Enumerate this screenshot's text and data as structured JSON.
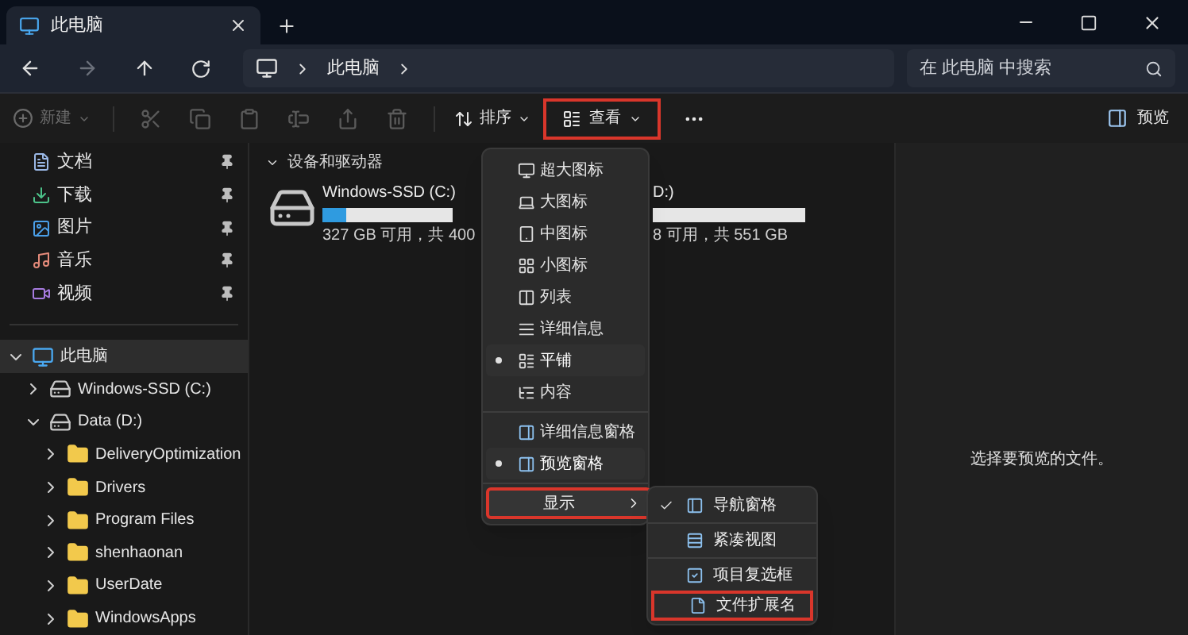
{
  "tab": {
    "title": "此电脑"
  },
  "address": {
    "path": [
      "此电脑"
    ]
  },
  "search": {
    "placeholder": "在 此电脑 中搜索"
  },
  "toolbar": {
    "new": {
      "label": "新建",
      "disabled": true
    },
    "edit_actions": [
      {
        "disabled": true
      },
      {
        "disabled": true
      },
      {
        "disabled": true
      },
      {
        "disabled": true
      },
      {
        "disabled": true
      },
      {
        "disabled": true
      }
    ],
    "sort": {
      "label": "排序"
    },
    "view": {
      "label": "查看",
      "highlighted": true
    },
    "preview": {
      "label": "预览"
    }
  },
  "sidebar": {
    "quick_access": [
      {
        "label": "文档",
        "pinned": true
      },
      {
        "label": "下载",
        "pinned": true
      },
      {
        "label": "图片",
        "pinned": true
      },
      {
        "label": "音乐",
        "pinned": true
      },
      {
        "label": "视频",
        "pinned": true
      }
    ],
    "tree": [
      {
        "label": "此电脑",
        "expanded": true,
        "selected": true,
        "children": [
          {
            "label": "Windows-SSD (C:)",
            "expanded": false,
            "selected": false
          },
          {
            "label": "Data (D:)",
            "expanded": true,
            "selected": false,
            "children": [
              {
                "label": "DeliveryOptimization",
                "expanded": false,
                "selected": false
              },
              {
                "label": "Drivers",
                "expanded": false,
                "selected": false
              },
              {
                "label": "Program Files",
                "expanded": false,
                "selected": false
              },
              {
                "label": "shenhaonan",
                "expanded": false,
                "selected": false
              },
              {
                "label": "UserDate",
                "expanded": false,
                "selected": false
              },
              {
                "label": "WindowsApps",
                "expanded": false,
                "selected": false
              }
            ]
          }
        ]
      }
    ]
  },
  "content": {
    "section": {
      "title": "设备和驱动器",
      "expanded": true
    },
    "drives": [
      {
        "name": "Windows-SSD (C:)",
        "level": 0.18,
        "space": "327 GB 可用，共 400"
      },
      {
        "name": "D:)",
        "space": "8 可用，共 551 GB"
      }
    ]
  },
  "view_menu": {
    "groups": [
      [
        {
          "label": "超大图标",
          "selected": false,
          "highlighted": false
        },
        {
          "label": "大图标",
          "selected": false,
          "highlighted": false
        },
        {
          "label": "中图标",
          "selected": false,
          "highlighted": false
        },
        {
          "label": "小图标",
          "selected": false,
          "highlighted": false
        },
        {
          "label": "列表",
          "selected": false,
          "highlighted": false
        },
        {
          "label": "详细信息",
          "selected": false,
          "highlighted": false
        },
        {
          "label": "平铺",
          "selected": true,
          "highlighted": false
        },
        {
          "label": "内容",
          "selected": false,
          "highlighted": false
        }
      ],
      [
        {
          "label": "详细信息窗格",
          "selected": false,
          "highlighted": false
        },
        {
          "label": "预览窗格",
          "selected": true,
          "highlighted": false
        }
      ],
      [
        {
          "label": "显示",
          "selected": false,
          "highlighted": true
        }
      ]
    ]
  },
  "show_menu": {
    "groups": [
      [
        {
          "label": "导航窗格",
          "checked": true,
          "highlighted": false
        }
      ],
      [
        {
          "label": "紧凑视图",
          "checked": false,
          "highlighted": false
        }
      ],
      [
        {
          "label": "项目复选框",
          "checked": false,
          "highlighted": false
        },
        {
          "label": "文件扩展名",
          "checked": false,
          "highlighted": true
        }
      ]
    ]
  },
  "preview_pane": {
    "message": "选择要预览的文件。"
  }
}
